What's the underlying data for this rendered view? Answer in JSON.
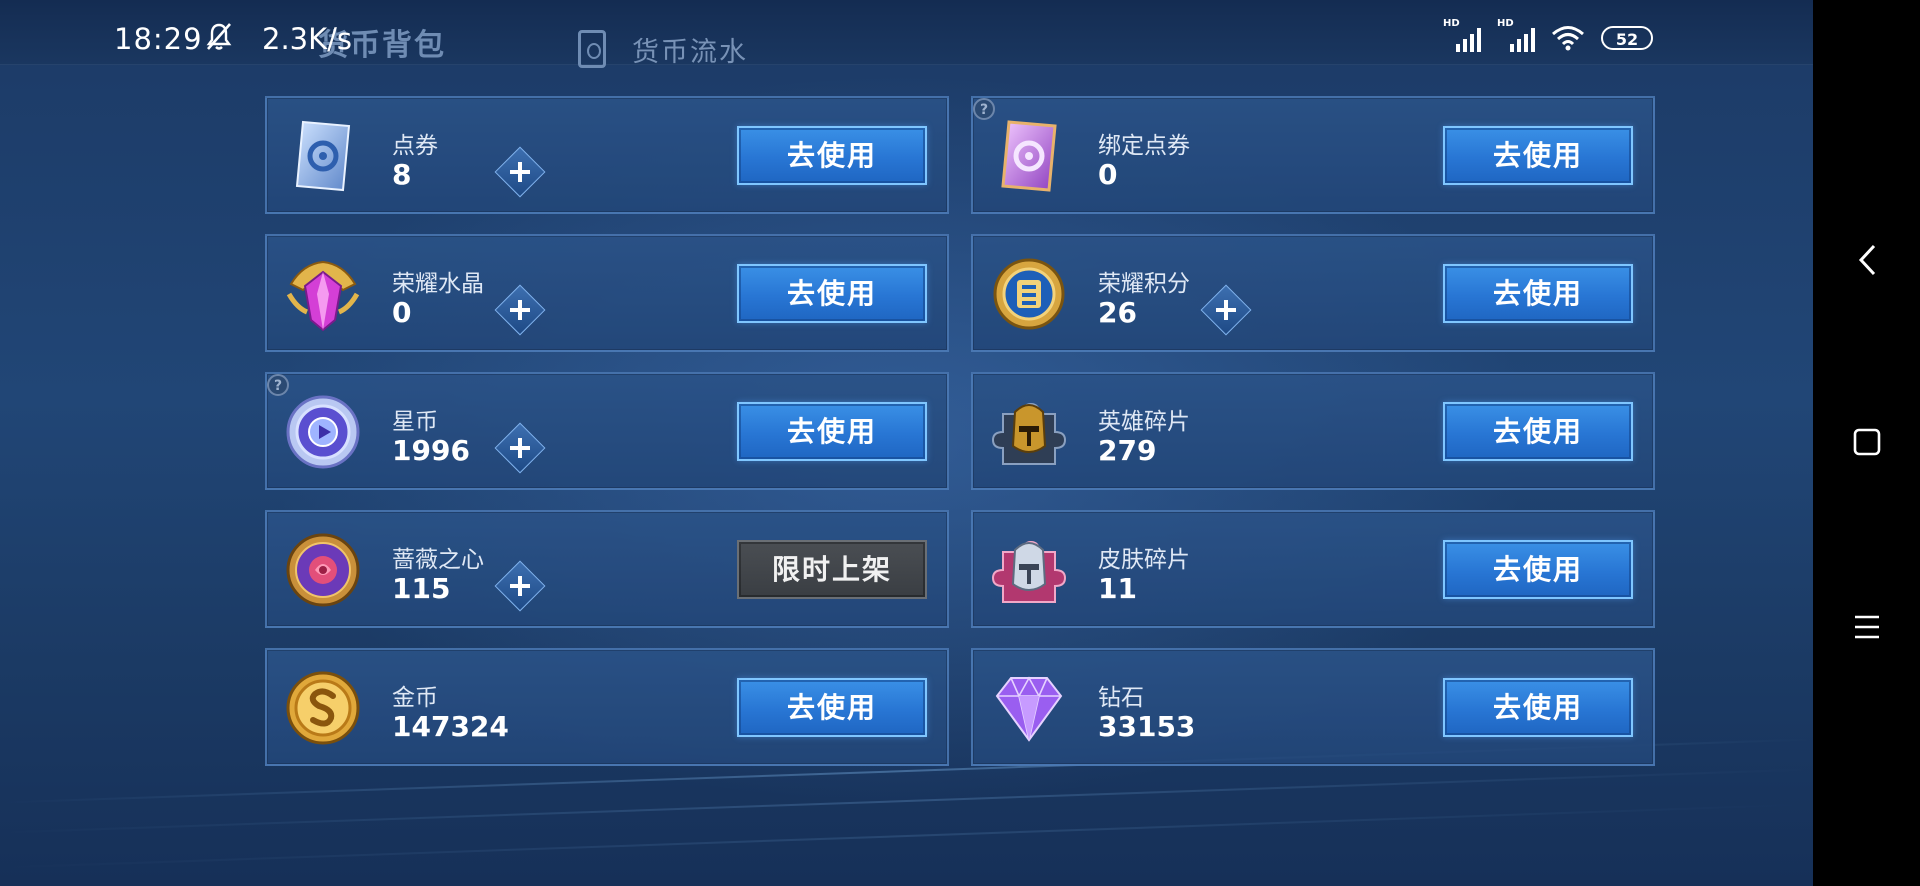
{
  "status_bar": {
    "time": "18:29",
    "net_speed": "2.3K/s",
    "battery": "52",
    "signal1_label": "HD",
    "signal2_label": "HD"
  },
  "tabs": {
    "active": "货币背包",
    "second": "货币流水"
  },
  "cards": [
    {
      "label": "点券",
      "value": "8",
      "button": "去使用",
      "icon": "voucher-card-icon",
      "has_plus": true,
      "has_help": false
    },
    {
      "label": "绑定点券",
      "value": "0",
      "button": "去使用",
      "icon": "bound-voucher-card-icon",
      "has_plus": false,
      "has_help": true
    },
    {
      "label": "荣耀水晶",
      "value": "0",
      "button": "去使用",
      "icon": "glory-crystal-icon",
      "has_plus": true,
      "has_help": false
    },
    {
      "label": "荣耀积分",
      "value": "26",
      "button": "去使用",
      "icon": "glory-points-icon",
      "has_plus": true,
      "has_help": false
    },
    {
      "label": "星币",
      "value": "1996",
      "button": "去使用",
      "icon": "star-coin-icon",
      "has_plus": true,
      "has_help": true
    },
    {
      "label": "英雄碎片",
      "value": "279",
      "button": "去使用",
      "icon": "hero-fragment-icon",
      "has_plus": false,
      "has_help": false
    },
    {
      "label": "蔷薇之心",
      "value": "115",
      "button": "限时上架",
      "icon": "rose-heart-icon",
      "has_plus": true,
      "has_help": false,
      "button_disabled": true
    },
    {
      "label": "皮肤碎片",
      "value": "11",
      "button": "去使用",
      "icon": "skin-fragment-icon",
      "has_plus": false,
      "has_help": false
    },
    {
      "label": "金币",
      "value": "147324",
      "button": "去使用",
      "icon": "gold-coin-icon",
      "has_plus": false,
      "has_help": false
    },
    {
      "label": "钻石",
      "value": "33153",
      "button": "去使用",
      "icon": "diamond-icon",
      "has_plus": false,
      "has_help": false
    }
  ],
  "icons": {
    "help": "?"
  },
  "colors": {
    "button_blue": "#2876d4",
    "button_disabled": "#3a3e43",
    "card_bg": "#2a5287",
    "page_bg": "#1c3a66"
  }
}
